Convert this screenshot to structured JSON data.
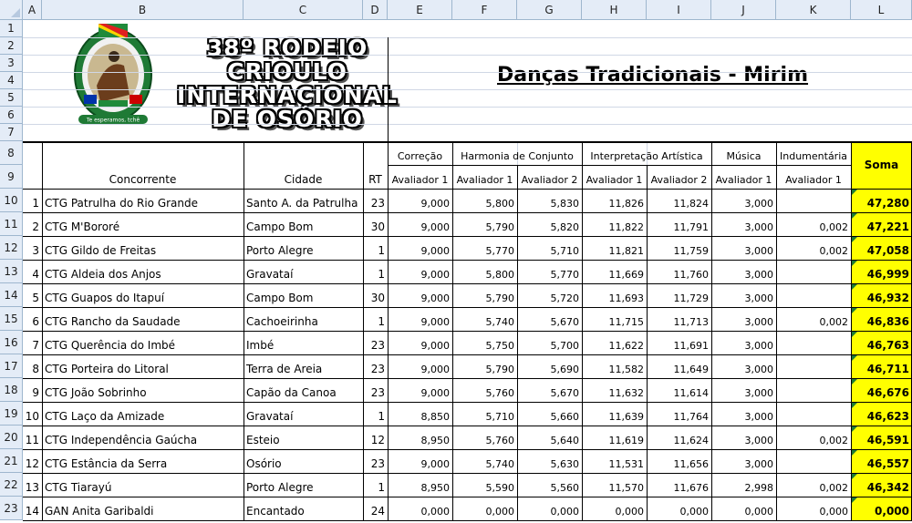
{
  "columns": [
    "A",
    "B",
    "C",
    "D",
    "E",
    "F",
    "G",
    "H",
    "I",
    "J",
    "K",
    "L"
  ],
  "rows_numbers": [
    "1",
    "2",
    "3",
    "4",
    "5",
    "6",
    "7",
    "8",
    "9",
    "10",
    "11",
    "12",
    "13",
    "14",
    "15",
    "16",
    "17",
    "18",
    "19",
    "20",
    "21",
    "22",
    "23"
  ],
  "banner": {
    "line1": "38º RODEIO CRIOULO",
    "line2": "INTERNACIONAL",
    "line3": "DE OSÓRIO",
    "logo_text": "Te esperamos, tchê"
  },
  "title": "Danças Tradicionais - Mirim",
  "headers": {
    "concorrente": "Concorrente",
    "cidade": "Cidade",
    "rt": "RT",
    "correcao": "Correção",
    "harmonia": "Harmonia de Conjunto",
    "interpretacao": "Interpretação Artística",
    "musica": "Música",
    "indumentaria": "Indumentária",
    "soma": "Soma",
    "av1": "Avaliador 1",
    "av2": "Avaliador 2"
  },
  "colors": {
    "soma_bg": "#ffff00",
    "header_bg": "#e4ecf7",
    "grid": "#d0d7e5"
  },
  "entries": [
    {
      "n": "1",
      "concorrente": "CTG Patrulha do Rio Grande",
      "cidade": "Santo A. da Patrulha",
      "rt": "23",
      "e": "9,000",
      "f": "5,800",
      "g": "5,830",
      "h": "11,826",
      "i": "11,824",
      "j": "3,000",
      "k": "",
      "soma": "47,280"
    },
    {
      "n": "2",
      "concorrente": "CTG M'Bororé",
      "cidade": "Campo Bom",
      "rt": "30",
      "e": "9,000",
      "f": "5,790",
      "g": "5,820",
      "h": "11,822",
      "i": "11,791",
      "j": "3,000",
      "k": "0,002",
      "soma": "47,221"
    },
    {
      "n": "3",
      "concorrente": "CTG Gildo de Freitas",
      "cidade": "Porto Alegre",
      "rt": "1",
      "e": "9,000",
      "f": "5,770",
      "g": "5,710",
      "h": "11,821",
      "i": "11,759",
      "j": "3,000",
      "k": "0,002",
      "soma": "47,058"
    },
    {
      "n": "4",
      "concorrente": "CTG Aldeia dos Anjos",
      "cidade": "Gravataí",
      "rt": "1",
      "e": "9,000",
      "f": "5,800",
      "g": "5,770",
      "h": "11,669",
      "i": "11,760",
      "j": "3,000",
      "k": "",
      "soma": "46,999"
    },
    {
      "n": "5",
      "concorrente": "CTG Guapos do Itapuí",
      "cidade": "Campo Bom",
      "rt": "30",
      "e": "9,000",
      "f": "5,790",
      "g": "5,720",
      "h": "11,693",
      "i": "11,729",
      "j": "3,000",
      "k": "",
      "soma": "46,932"
    },
    {
      "n": "6",
      "concorrente": "CTG Rancho da Saudade",
      "cidade": "Cachoeirinha",
      "rt": "1",
      "e": "9,000",
      "f": "5,740",
      "g": "5,670",
      "h": "11,715",
      "i": "11,713",
      "j": "3,000",
      "k": "0,002",
      "soma": "46,836"
    },
    {
      "n": "7",
      "concorrente": "CTG Querência do Imbé",
      "cidade": "Imbé",
      "rt": "23",
      "e": "9,000",
      "f": "5,750",
      "g": "5,700",
      "h": "11,622",
      "i": "11,691",
      "j": "3,000",
      "k": "",
      "soma": "46,763"
    },
    {
      "n": "8",
      "concorrente": "CTG Porteira do Litoral",
      "cidade": "Terra de Areia",
      "rt": "23",
      "e": "9,000",
      "f": "5,790",
      "g": "5,690",
      "h": "11,582",
      "i": "11,649",
      "j": "3,000",
      "k": "",
      "soma": "46,711"
    },
    {
      "n": "9",
      "concorrente": "CTG João Sobrinho",
      "cidade": "Capão da Canoa",
      "rt": "23",
      "e": "9,000",
      "f": "5,760",
      "g": "5,670",
      "h": "11,632",
      "i": "11,614",
      "j": "3,000",
      "k": "",
      "soma": "46,676"
    },
    {
      "n": "10",
      "concorrente": "CTG Laço da Amizade",
      "cidade": "Gravataí",
      "rt": "1",
      "e": "8,850",
      "f": "5,710",
      "g": "5,660",
      "h": "11,639",
      "i": "11,764",
      "j": "3,000",
      "k": "",
      "soma": "46,623"
    },
    {
      "n": "11",
      "concorrente": "CTG Independência Gaúcha",
      "cidade": "Esteio",
      "rt": "12",
      "e": "8,950",
      "f": "5,760",
      "g": "5,640",
      "h": "11,619",
      "i": "11,624",
      "j": "3,000",
      "k": "0,002",
      "soma": "46,591"
    },
    {
      "n": "12",
      "concorrente": "CTG Estância da Serra",
      "cidade": "Osório",
      "rt": "23",
      "e": "9,000",
      "f": "5,740",
      "g": "5,630",
      "h": "11,531",
      "i": "11,656",
      "j": "3,000",
      "k": "",
      "soma": "46,557"
    },
    {
      "n": "13",
      "concorrente": "CTG Tiarayú",
      "cidade": "Porto Alegre",
      "rt": "1",
      "e": "8,950",
      "f": "5,590",
      "g": "5,560",
      "h": "11,570",
      "i": "11,676",
      "j": "2,998",
      "k": "0,002",
      "soma": "46,342"
    },
    {
      "n": "14",
      "concorrente": "GAN Anita Garibaldi",
      "cidade": "Encantado",
      "rt": "24",
      "e": "0,000",
      "f": "0,000",
      "g": "0,000",
      "h": "0,000",
      "i": "0,000",
      "j": "0,000",
      "k": "0,000",
      "soma": "0,000"
    }
  ]
}
